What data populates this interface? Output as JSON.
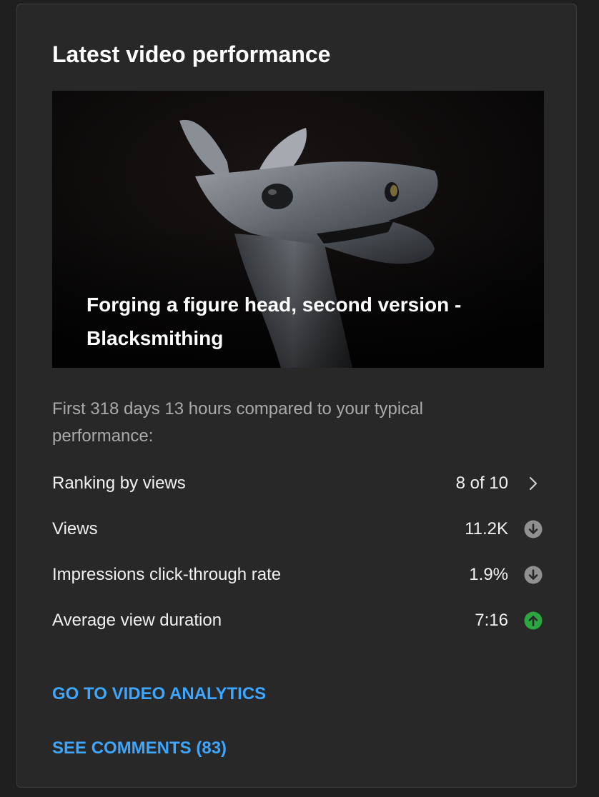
{
  "card": {
    "title": "Latest video performance"
  },
  "video": {
    "title": "Forging a figure head, second version - Blacksmithing",
    "thumbnail_description": "forged iron horse figure head"
  },
  "comparison_text": "First 318 days 13 hours compared to your typical performance:",
  "metrics": [
    {
      "label": "Ranking by views",
      "value": "8 of 10",
      "icon": "chevron-right-icon"
    },
    {
      "label": "Views",
      "value": "11.2K",
      "icon": "arrow-down-circle-icon",
      "trend": "down"
    },
    {
      "label": "Impressions click-through rate",
      "value": "1.9%",
      "icon": "arrow-down-circle-icon",
      "trend": "down"
    },
    {
      "label": "Average view duration",
      "value": "7:16",
      "icon": "arrow-up-circle-icon",
      "trend": "up"
    }
  ],
  "links": {
    "analytics": "GO TO VIDEO ANALYTICS",
    "comments": "SEE COMMENTS (83)"
  },
  "colors": {
    "background": "#1f1f1f",
    "card": "#282828",
    "link": "#3ea6ff",
    "trend_up": "#2ba640",
    "trend_down": "#909090"
  }
}
